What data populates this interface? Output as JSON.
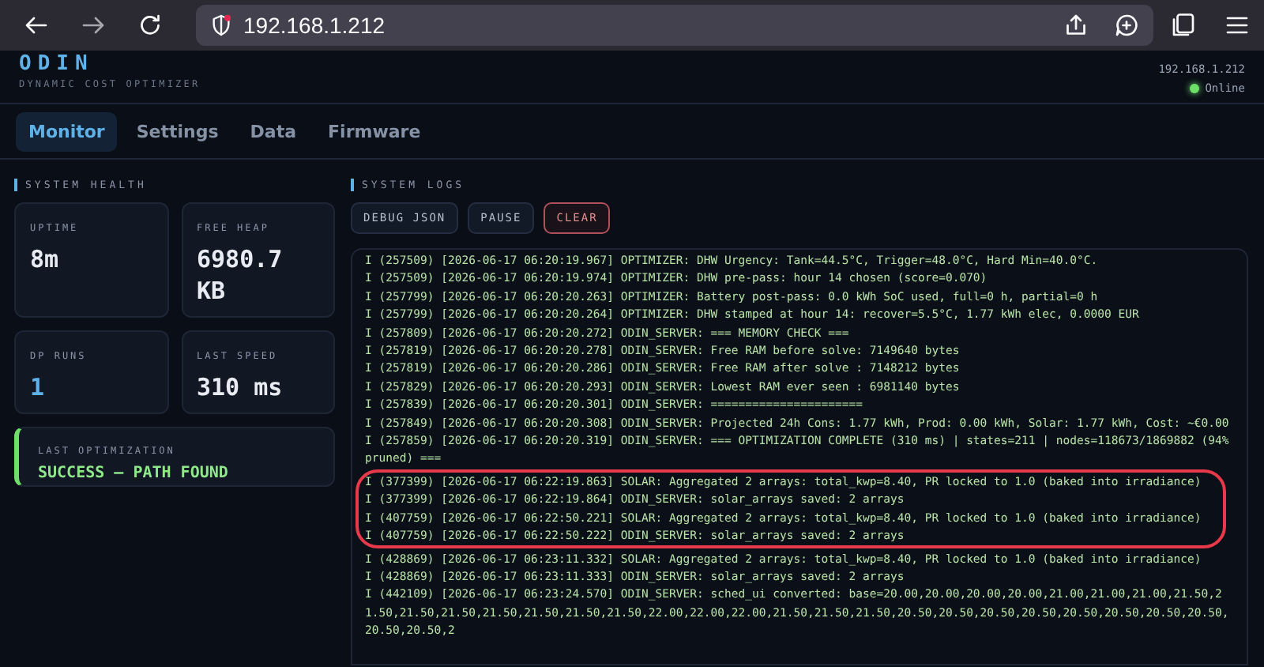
{
  "browser": {
    "url": "192.168.1.212"
  },
  "header": {
    "title": "ODIN",
    "subtitle": "DYNAMIC COST OPTIMIZER",
    "host": "192.168.1.212",
    "status": "Online",
    "online": true
  },
  "tabs": [
    {
      "label": "Monitor",
      "selected": true
    },
    {
      "label": "Settings",
      "selected": false
    },
    {
      "label": "Data",
      "selected": false
    },
    {
      "label": "Firmware",
      "selected": false
    }
  ],
  "system_health": {
    "title": "SYSTEM HEALTH",
    "stats": [
      {
        "label": "UPTIME",
        "value": "8m",
        "accent": false
      },
      {
        "label": "FREE HEAP",
        "value": "6980.7 KB",
        "accent": false
      },
      {
        "label": "DP RUNS",
        "value": "1",
        "accent": true
      },
      {
        "label": "LAST SPEED",
        "value": "310 ms",
        "accent": false
      }
    ],
    "last_optimization": {
      "label": "LAST OPTIMIZATION",
      "value": "SUCCESS — PATH FOUND",
      "success": true
    }
  },
  "system_logs": {
    "title": "SYSTEM LOGS",
    "buttons": [
      {
        "label": "DEBUG JSON",
        "kind": "default"
      },
      {
        "label": "PAUSE",
        "kind": "default"
      },
      {
        "label": "CLEAR",
        "kind": "danger"
      }
    ],
    "lines": [
      "I (257509) [2026-06-17 06:20:19.967] OPTIMIZER: DHW Urgency: Tank=44.5°C, Trigger=48.0°C, Hard Min=40.0°C.",
      "I (257509) [2026-06-17 06:20:19.974] OPTIMIZER: DHW pre-pass: hour 14 chosen (score=0.070)",
      "I (257799) [2026-06-17 06:20:20.263] OPTIMIZER: Battery post-pass: 0.0 kWh SoC used, full=0 h, partial=0 h",
      "I (257799) [2026-06-17 06:20:20.264] OPTIMIZER: DHW stamped at hour 14: recover=5.5°C, 1.77 kWh elec, 0.0000 EUR",
      "I (257809) [2026-06-17 06:20:20.272] ODIN_SERVER: === MEMORY CHECK ===",
      "I (257819) [2026-06-17 06:20:20.278] ODIN_SERVER: Free RAM before solve: 7149640 bytes",
      "I (257819) [2026-06-17 06:20:20.286] ODIN_SERVER: Free RAM after solve : 7148212 bytes",
      "I (257829) [2026-06-17 06:20:20.293] ODIN_SERVER: Lowest RAM ever seen : 6981140 bytes",
      "I (257839) [2026-06-17 06:20:20.301] ODIN_SERVER: ======================",
      "I (257849) [2026-06-17 06:20:20.308] ODIN_SERVER: Projected 24h Cons: 1.77 kWh, Prod: 0.00 kWh, Solar: 1.77 kWh, Cost: ~€0.00",
      "I (257859) [2026-06-17 06:20:20.319] ODIN_SERVER: === OPTIMIZATION COMPLETE (310 ms) | states=211 | nodes=118673/1869882 (94% pruned) ===",
      {
        "text": "I (377399) [2026-06-17 06:22:19.863] SOLAR: Aggregated 2 arrays: total_kwp=8.40, PR locked to 1.0 (baked into irradiance)",
        "circled": true
      },
      {
        "text": "I (377399) [2026-06-17 06:22:19.864] ODIN_SERVER: solar_arrays saved: 2 arrays",
        "circled": true
      },
      {
        "text": "I (407759) [2026-06-17 06:22:50.221] SOLAR: Aggregated 2 arrays: total_kwp=8.40, PR locked to 1.0 (baked into irradiance)",
        "circled": true
      },
      {
        "text": "I (407759) [2026-06-17 06:22:50.222] ODIN_SERVER: solar_arrays saved: 2 arrays",
        "circled": true
      },
      "I (428869) [2026-06-17 06:23:11.332] SOLAR: Aggregated 2 arrays: total_kwp=8.40, PR locked to 1.0 (baked into irradiance)",
      "I (428869) [2026-06-17 06:23:11.333] ODIN_SERVER: solar_arrays saved: 2 arrays",
      "I (442109) [2026-06-17 06:23:24.570] ODIN_SERVER: sched_ui converted: base=20.00,20.00,20.00,20.00,21.00,21.00,21.00,21.50,21.50,21.50,21.50,21.50,21.50,21.50,21.50,22.00,22.00,22.00,21.50,21.50,21.50,20.50,20.50,20.50,20.50,20.50,20.50,20.50,20.50,20.50,20.50,2"
    ]
  }
}
